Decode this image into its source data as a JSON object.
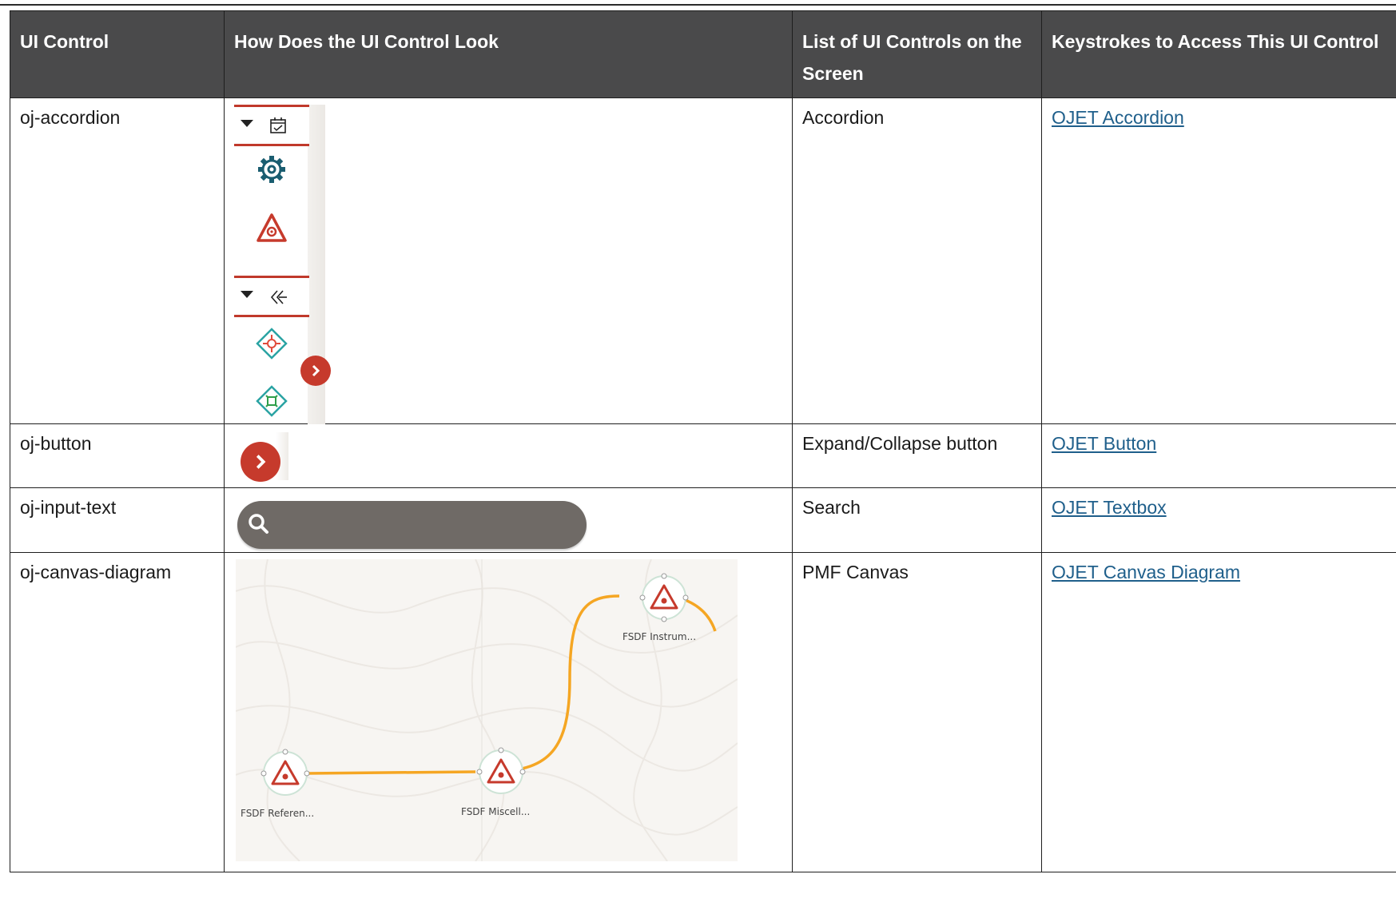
{
  "table": {
    "headers": [
      "UI Control",
      "How Does the UI Control Look",
      "List of UI Controls on the Screen",
      "Keystrokes to Access This UI Control"
    ],
    "rows": [
      {
        "control": "oj-accordion",
        "list": "Accordion",
        "link": "OJET Accordion"
      },
      {
        "control": "oj-button",
        "list": "Expand/Collapse button",
        "link": "OJET Button"
      },
      {
        "control": "oj-input-text",
        "list": "Search",
        "link": "OJET Textbox"
      },
      {
        "control": "oj-canvas-diagram",
        "list": "PMF Canvas",
        "link": "OJET Canvas Diagram"
      }
    ]
  },
  "canvas": {
    "nodes": [
      {
        "label": "FSDF Referen..."
      },
      {
        "label": "FSDF Miscell..."
      },
      {
        "label": "FSDF Instrum..."
      }
    ]
  },
  "colors": {
    "header_bg": "#4a4a4b",
    "accent_red": "#c63a2c",
    "link_orange": "#f5a623",
    "teal": "#1a6b7a"
  },
  "icons": [
    "caret-down-icon",
    "calendar-icon",
    "gear-icon",
    "warning-gear-icon",
    "double-chevron-left-icon",
    "diamond-red-icon",
    "diamond-green-icon",
    "chevron-right-icon",
    "search-icon"
  ]
}
